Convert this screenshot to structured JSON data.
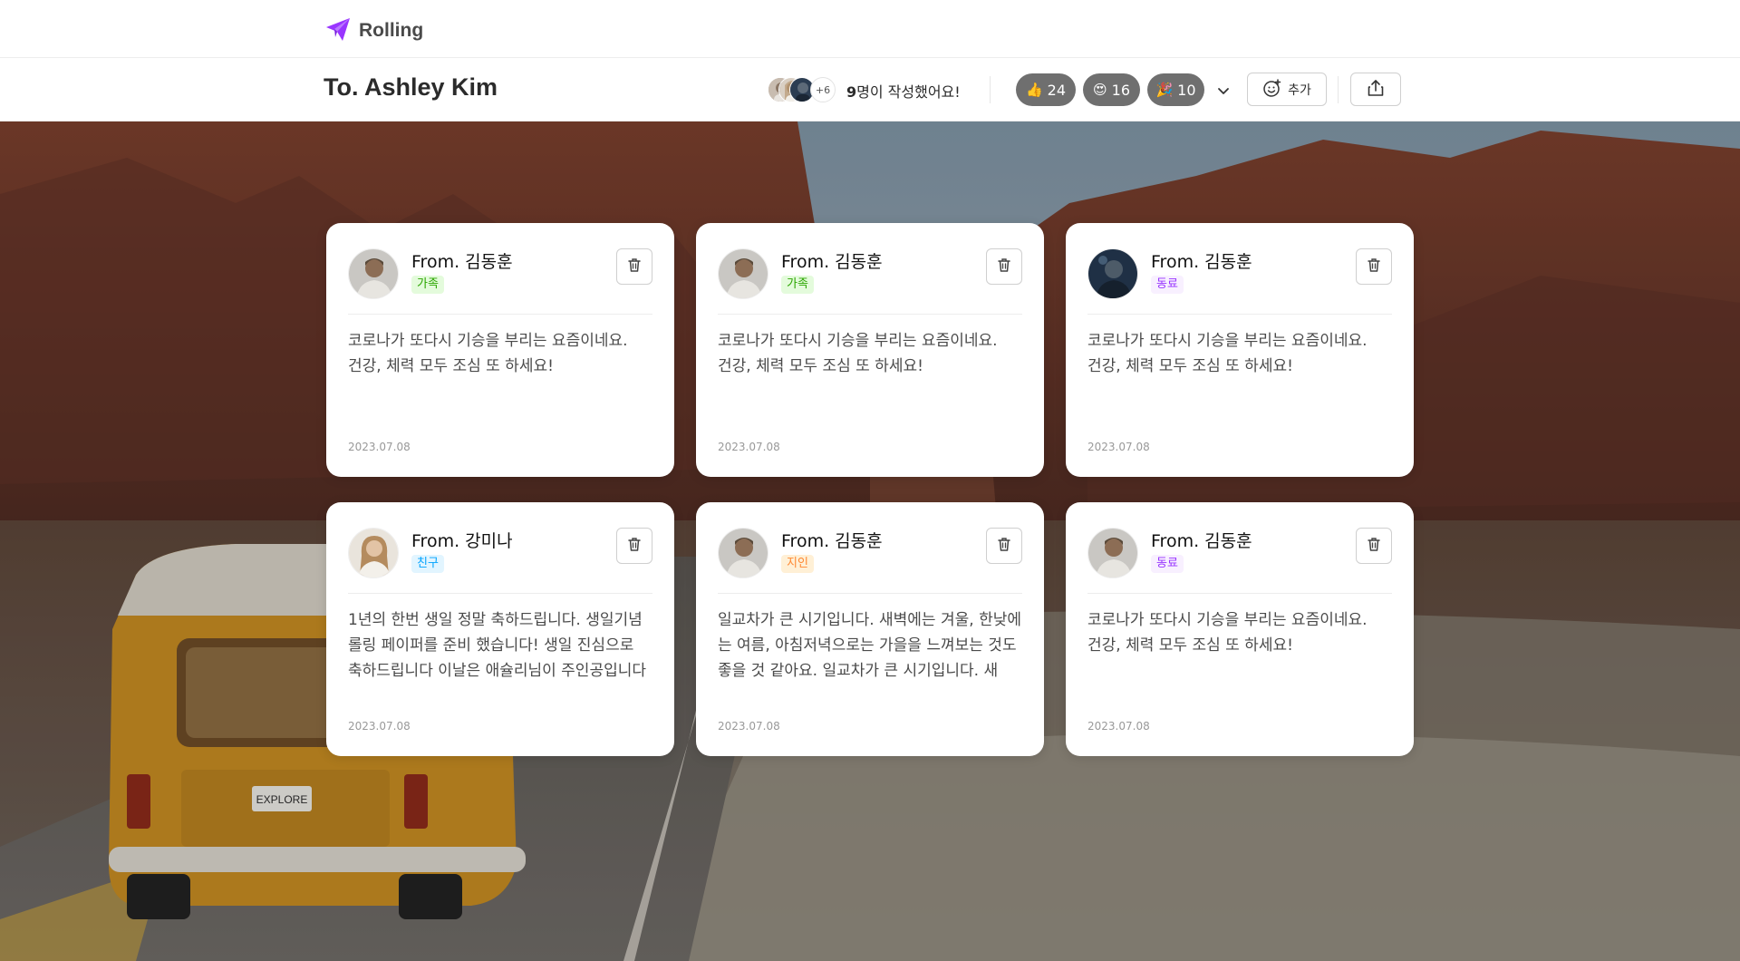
{
  "brand": {
    "name": "Rolling",
    "color": "#9935ff"
  },
  "header": {
    "to": "To. Ashley Kim",
    "avatars_more": "+6",
    "writer_count_num": "9",
    "writer_count_suffix": "명이 작성했어요!",
    "reactions": [
      {
        "emoji": "👍",
        "count": "24"
      },
      {
        "emoji": "😍",
        "count": "16"
      },
      {
        "emoji": "🎉",
        "count": "10"
      }
    ],
    "add_label": "추가"
  },
  "cards": [
    {
      "from": "From. 김동훈",
      "relation": "가족",
      "relation_type": "family",
      "message": "코로나가 또다시 기승을 부리는 요즘이네요.\n건강, 체력 모두 조심 또 하세요!",
      "date": "2023.07.08",
      "avatar": "man"
    },
    {
      "from": "From. 김동훈",
      "relation": "가족",
      "relation_type": "family",
      "message": "코로나가 또다시 기승을 부리는 요즘이네요.\n건강, 체력 모두 조심 또 하세요!",
      "date": "2023.07.08",
      "avatar": "man"
    },
    {
      "from": "From. 김동훈",
      "relation": "동료",
      "relation_type": "colleague",
      "message": "코로나가 또다시 기승을 부리는 요즘이네요.\n건강, 체력 모두 조심 또 하세요!",
      "date": "2023.07.08",
      "avatar": "dark"
    },
    {
      "from": "From. 강미나",
      "relation": "친구",
      "relation_type": "friend",
      "message": "1년의 한번 생일 정말 축하드립니다. 생일기념 롤링 페이퍼를 준비 했습니다! 생일 진심으로 축하드립니다 이날은 애슐리님이 주인공입니다✌",
      "date": "2023.07.08",
      "avatar": "woman"
    },
    {
      "from": "From. 김동훈",
      "relation": "지인",
      "relation_type": "acquaint",
      "message": "일교차가 큰 시기입니다. 새벽에는 겨울, 한낮에는 여름, 아침저녁으로는 가을을 느껴보는 것도 좋을 것 같아요. 일교차가 큰 시기입니다. 새벽...",
      "date": "2023.07.08",
      "avatar": "man"
    },
    {
      "from": "From. 김동훈",
      "relation": "동료",
      "relation_type": "colleague",
      "message": "코로나가 또다시 기승을 부리는 요즘이네요.\n건강, 체력 모두 조심 또 하세요!",
      "date": "2023.07.08",
      "avatar": "man"
    }
  ],
  "background": {
    "plate_text": "EXPLORE"
  }
}
